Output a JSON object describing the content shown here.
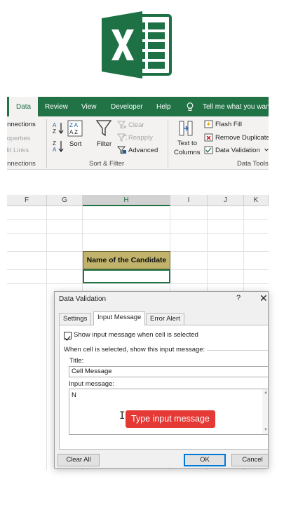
{
  "ribbon": {
    "tabs": [
      "Data",
      "Review",
      "View",
      "Developer",
      "Help"
    ],
    "active_tab": "Data",
    "tell_me": "Tell me what you want",
    "connections_group": {
      "items": [
        "Connections",
        "Properties",
        "Edit Links"
      ],
      "label": "Connections"
    },
    "sort_filter_group": {
      "sort_label": "Sort",
      "filter_label": "Filter",
      "clear_label": "Clear",
      "reapply_label": "Reapply",
      "advanced_label": "Advanced",
      "label": "Sort & Filter"
    },
    "data_tools_group": {
      "text_to_columns_line1": "Text to",
      "text_to_columns_line2": "Columns",
      "flash_fill": "Flash Fill",
      "remove_duplicates": "Remove Duplicates",
      "data_validation": "Data Validation",
      "label": "Data Tools"
    }
  },
  "sheet": {
    "columns": [
      "F",
      "G",
      "H",
      "I",
      "J",
      "K"
    ],
    "selected_column": "H",
    "header_cell": "Name of the Candidate",
    "header_fill": "#c2b36c"
  },
  "dialog": {
    "title": "Data Validation",
    "help": "?",
    "close": "✕",
    "tabs": [
      "Settings",
      "Input Message",
      "Error Alert"
    ],
    "active_tab": "Input Message",
    "show_message_checkbox": {
      "label": "Show input message when cell is selected",
      "checked": true
    },
    "when_selected_label": "When cell is selected, show this input message:",
    "title_field": {
      "label": "Title:",
      "value": "Cell Message"
    },
    "message_field": {
      "label": "Input message:",
      "value": "N"
    },
    "buttons": {
      "clear_all": "Clear All",
      "ok": "OK",
      "cancel": "Cancel"
    }
  },
  "annotation": {
    "text": "Type input message",
    "color": "#e53935"
  },
  "colors": {
    "excel_green": "#217346",
    "ribbon_bg": "#f3f2f1",
    "dialog_bg": "#f0f0f0"
  }
}
